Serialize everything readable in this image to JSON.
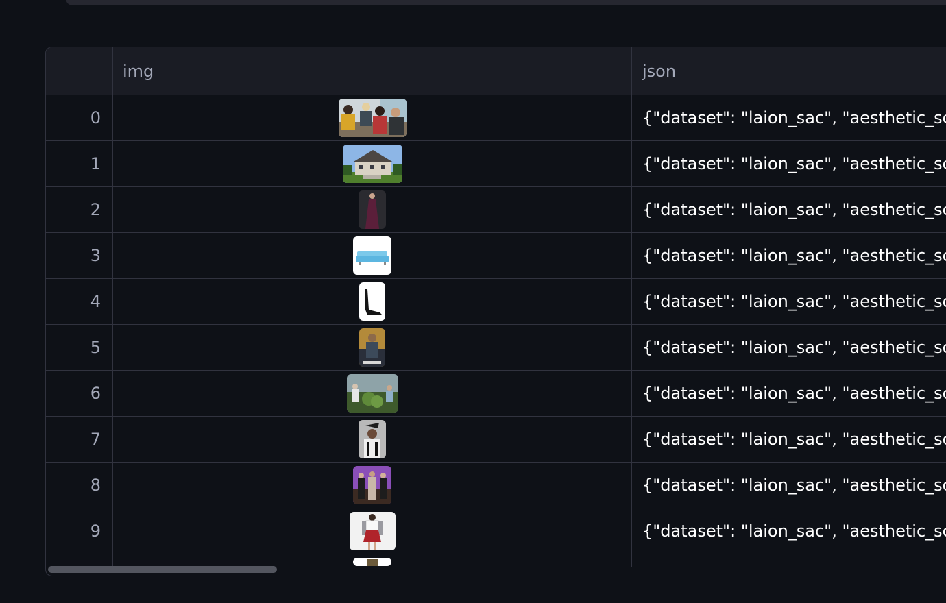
{
  "table": {
    "columns": {
      "index": "",
      "img": "img",
      "json": "json"
    },
    "rows": [
      {
        "index": "0",
        "json": "{\"dataset\": \"laion_sac\", \"aesthetic_score\": ",
        "thumb": "group-of-people-image"
      },
      {
        "index": "1",
        "json": "{\"dataset\": \"laion_sac\", \"aesthetic_score\": ",
        "thumb": "house-image"
      },
      {
        "index": "2",
        "json": "{\"dataset\": \"laion_sac\", \"aesthetic_score\": ",
        "thumb": "woman-in-gown-image"
      },
      {
        "index": "3",
        "json": "{\"dataset\": \"laion_sac\", \"aesthetic_score\": ",
        "thumb": "blue-sofa-image"
      },
      {
        "index": "4",
        "json": "{\"dataset\": \"laion_sac\", \"aesthetic_score\": ",
        "thumb": "high-heel-shoe-image"
      },
      {
        "index": "5",
        "json": "{\"dataset\": \"laion_sac\", \"aesthetic_score\": ",
        "thumb": "movie-poster-image"
      },
      {
        "index": "6",
        "json": "{\"dataset\": \"laion_sac\", \"aesthetic_score\": ",
        "thumb": "gardening-people-image"
      },
      {
        "index": "7",
        "json": "{\"dataset\": \"laion_sac\", \"aesthetic_score\": ",
        "thumb": "woman-with-hat-image"
      },
      {
        "index": "8",
        "json": "{\"dataset\": \"laion_sac\", \"aesthetic_score\": ",
        "thumb": "fashion-group-image"
      },
      {
        "index": "9",
        "json": "{\"dataset\": \"laion_sac\", \"aesthetic_score\": ",
        "thumb": "woman-red-skirt-image"
      }
    ]
  },
  "colors": {
    "background": "#0e1117",
    "header": "#1a1c24",
    "border": "#31333f",
    "text": "#ffffff",
    "muted": "#a3a8b8"
  }
}
